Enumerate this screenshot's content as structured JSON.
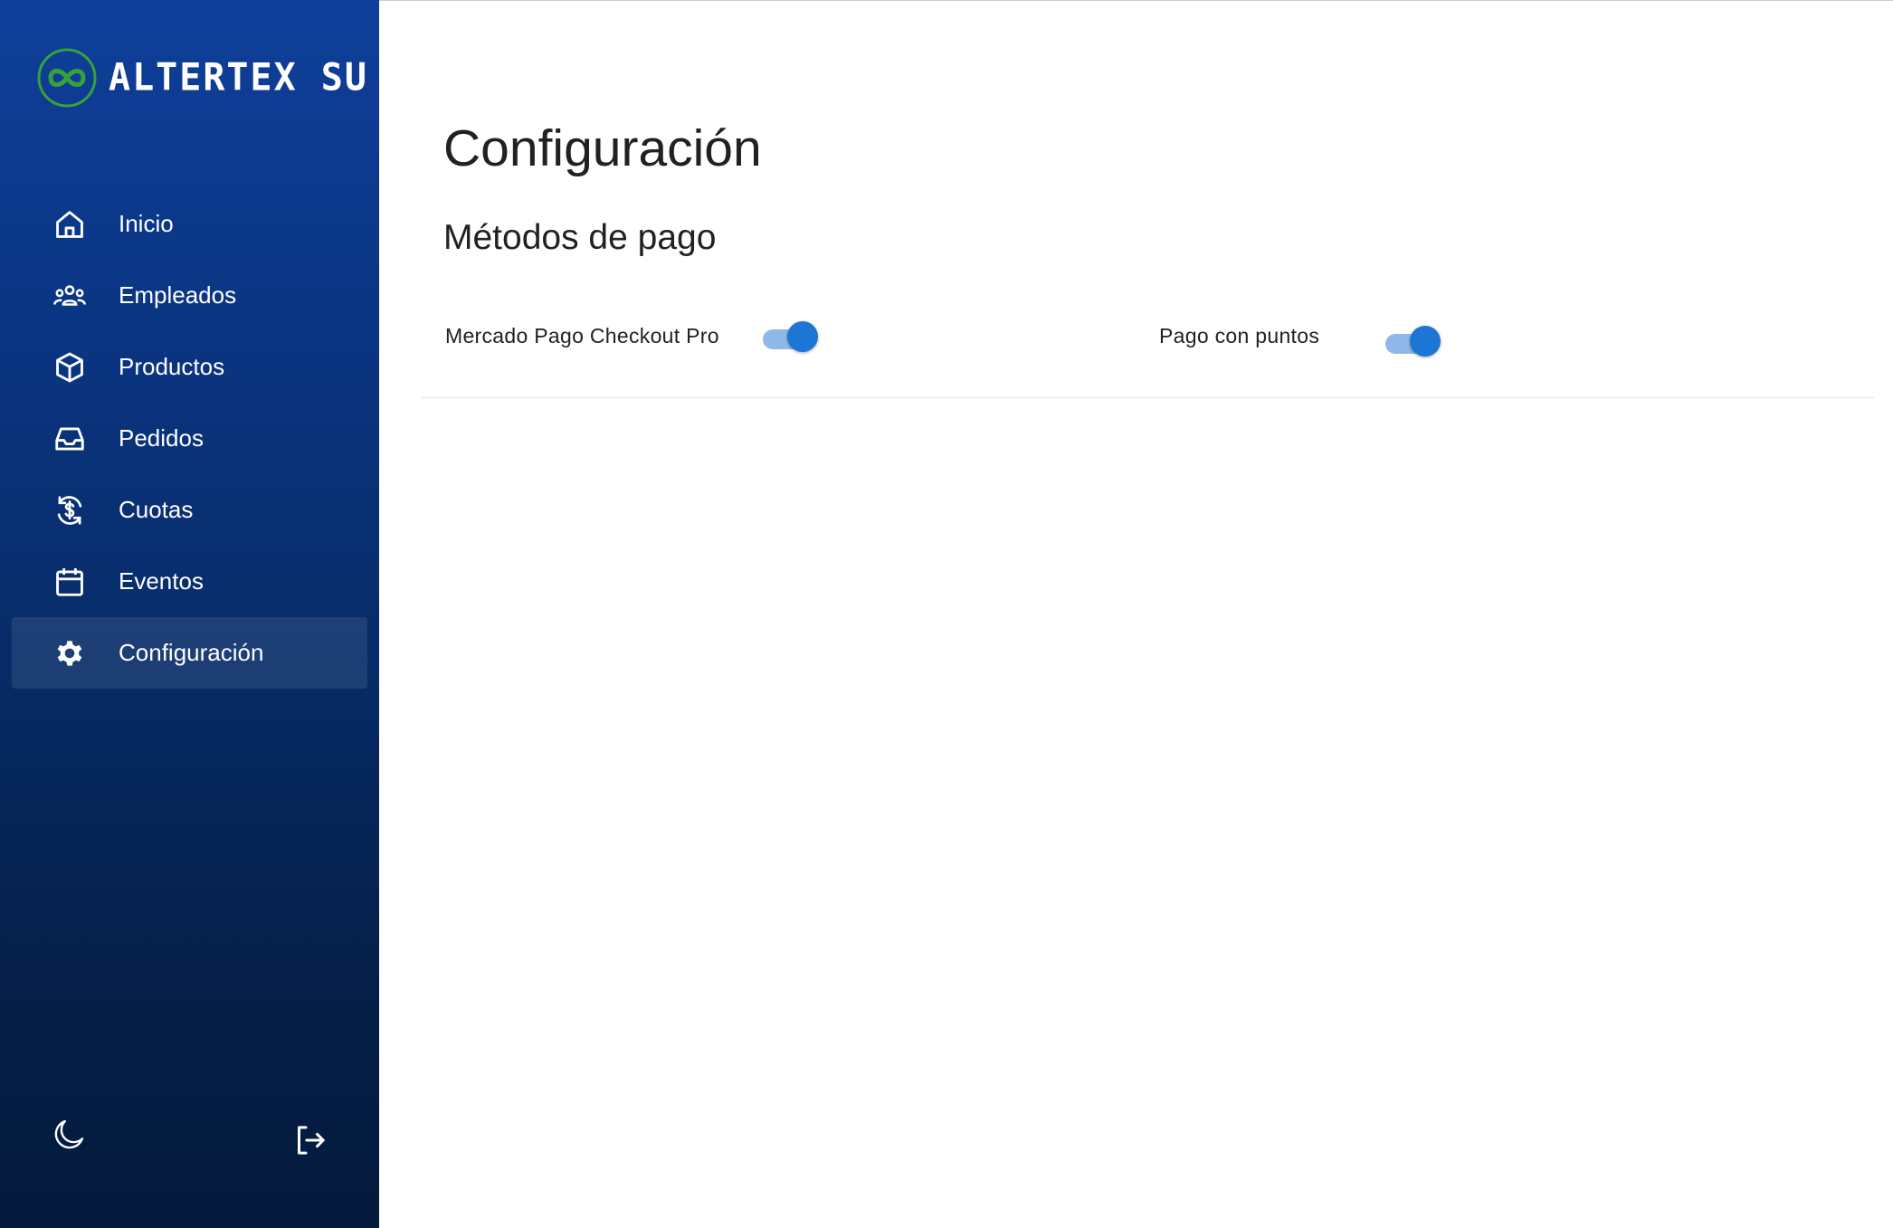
{
  "brand": {
    "name": "ALTERTEX SU",
    "mark_color": "#36a23a"
  },
  "sidebar": {
    "items": [
      {
        "label": "Inicio",
        "icon": "home-icon",
        "active": false
      },
      {
        "label": "Empleados",
        "icon": "users-icon",
        "active": false
      },
      {
        "label": "Productos",
        "icon": "box-icon",
        "active": false
      },
      {
        "label": "Pedidos",
        "icon": "inbox-icon",
        "active": false
      },
      {
        "label": "Cuotas",
        "icon": "dollar-refresh-icon",
        "active": false
      },
      {
        "label": "Eventos",
        "icon": "calendar-icon",
        "active": false
      },
      {
        "label": "Configuración",
        "icon": "gear-icon",
        "active": true
      }
    ],
    "footer": {
      "theme_icon": "moon-icon",
      "logout_icon": "logout-icon"
    }
  },
  "main": {
    "title": "Configuración",
    "section_title": "Métodos de pago",
    "settings": [
      {
        "label": "Mercado Pago Checkout Pro",
        "enabled": true
      },
      {
        "label": "Pago con puntos",
        "enabled": true
      }
    ]
  },
  "colors": {
    "sidebar_top": "#0f3f9a",
    "sidebar_bottom": "#041a3c",
    "toggle_thumb": "#1b76d6",
    "toggle_track": "#8fb8ea"
  }
}
